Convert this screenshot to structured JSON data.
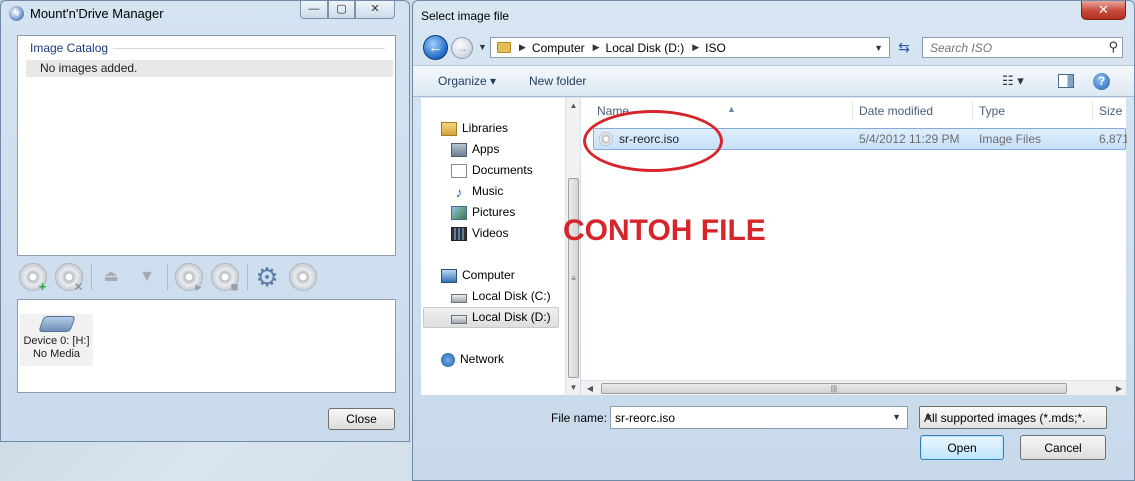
{
  "mnd_window": {
    "title": "Mount'n'Drive Manager",
    "controls": {
      "minimize": "—",
      "maximize": "▢",
      "close": "✕"
    },
    "catalog": {
      "legend": "Image Catalog",
      "rows": [
        "No images added."
      ]
    },
    "toolbar_icons": [
      "add-image-icon",
      "remove-image-icon",
      "mount-up-icon",
      "unmount-down-icon",
      "play-disc-icon",
      "stop-disc-icon",
      "settings-gear-icon",
      "disc-icon"
    ],
    "device": {
      "name": "Device 0: [H:]",
      "status": "No Media"
    },
    "close_label": "Close"
  },
  "dialog": {
    "title": "Select image file",
    "close_glyph": "✕",
    "breadcrumb": [
      "Computer",
      "Local Disk (D:)",
      "ISO"
    ],
    "search_placeholder": "Search ISO",
    "commands": {
      "organize": "Organize ▾",
      "new_folder": "New folder"
    },
    "nav_tree": [
      {
        "label": "Libraries",
        "icon": "libraries-icon",
        "level": 0
      },
      {
        "label": "Apps",
        "icon": "apps-icon",
        "level": 1
      },
      {
        "label": "Documents",
        "icon": "documents-icon",
        "level": 1
      },
      {
        "label": "Music",
        "icon": "music-icon",
        "level": 1
      },
      {
        "label": "Pictures",
        "icon": "pictures-icon",
        "level": 1
      },
      {
        "label": "Videos",
        "icon": "videos-icon",
        "level": 1
      },
      {
        "label": "Computer",
        "icon": "computer-icon",
        "level": 0
      },
      {
        "label": "Local Disk (C:)",
        "icon": "local-disk-icon",
        "level": 1
      },
      {
        "label": "Local Disk (D:)",
        "icon": "local-disk-icon",
        "level": 1,
        "selected": true
      },
      {
        "label": "Network",
        "icon": "network-icon",
        "level": 0
      }
    ],
    "columns": [
      "Name",
      "Date modified",
      "Type",
      "Size"
    ],
    "files": [
      {
        "name": "sr-reorc.iso",
        "date_modified": "5/4/2012 11:29 PM",
        "type": "Image Files",
        "size": "6,871"
      }
    ],
    "overlay_text": "CONTOH FILE",
    "file_name_label": "File name:",
    "file_name_value": "sr-reorc.iso",
    "filter_value": "All supported images (*.mds;*.r",
    "open_label": "Open",
    "cancel_label": "Cancel"
  },
  "colors": {
    "annotation_red": "#d7262b",
    "selection_blue": "#c6e0fa",
    "window_frame": "#c9dbec"
  }
}
